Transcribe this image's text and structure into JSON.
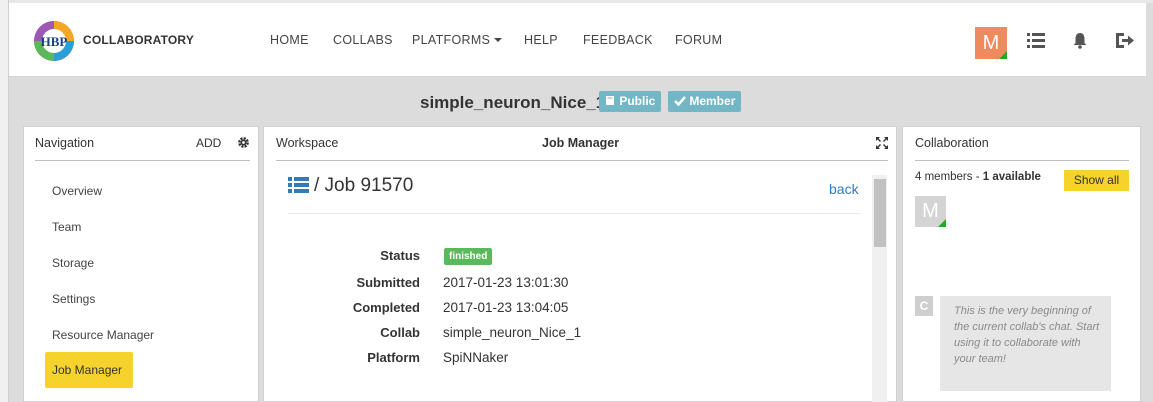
{
  "brand": "COLLABORATORY",
  "logo_text": "HBP",
  "nav_menu": [
    {
      "label": "HOME"
    },
    {
      "label": "COLLABS"
    },
    {
      "label": "PLATFORMS"
    },
    {
      "label": "HELP"
    },
    {
      "label": "FEEDBACK"
    },
    {
      "label": "FORUM"
    }
  ],
  "user": {
    "avatar_letter": "M",
    "avatar_color": "#ef8a5e",
    "status_color": "#22aa22"
  },
  "top_icons": [
    "list-icon",
    "bell-icon",
    "logout-icon"
  ],
  "collab": {
    "title": "simple_neuron_Nice_1",
    "badges": [
      {
        "label": "Public",
        "icon": "book-icon"
      },
      {
        "label": "Member",
        "icon": "check-icon"
      }
    ]
  },
  "navigation": {
    "header": "Navigation",
    "add_label": "ADD",
    "items": [
      {
        "label": "Overview"
      },
      {
        "label": "Team"
      },
      {
        "label": "Storage"
      },
      {
        "label": "Settings"
      },
      {
        "label": "Resource Manager"
      },
      {
        "label": "Job Manager",
        "active": true
      }
    ]
  },
  "workspace": {
    "header": "Workspace",
    "app_title": "Job Manager",
    "job_title": "/ Job 91570",
    "back_label": "back",
    "details": [
      {
        "label": "Status",
        "value": "finished"
      },
      {
        "label": "Submitted",
        "value": "2017-01-23 13:01:30"
      },
      {
        "label": "Completed",
        "value": "2017-01-23 13:04:05"
      },
      {
        "label": "Collab",
        "value": "simple_neuron_Nice_1"
      },
      {
        "label": "Platform",
        "value": "SpiNNaker"
      }
    ]
  },
  "collaboration": {
    "header": "Collaboration",
    "members_prefix": "4 members - ",
    "members_available": "1 available",
    "show_all_label": "Show all",
    "member_avatar_letter": "M",
    "chat_avatar_letter": "C",
    "chat_message": "This is the very beginning of the current collab's chat. Start using it to collaborate with your team!"
  },
  "colors": {
    "accent_yellow": "#f6d22c",
    "badge_teal": "#73b6c5",
    "status_green": "#5cb85c",
    "link_blue": "#337ab7"
  }
}
